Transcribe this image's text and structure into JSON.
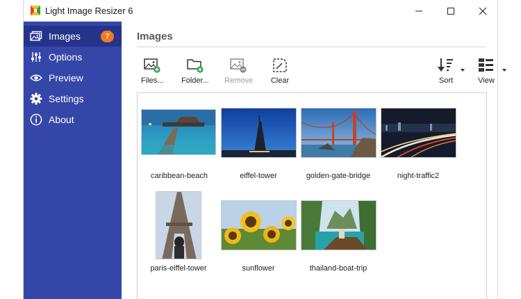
{
  "window": {
    "title": "Light Image Resizer 6"
  },
  "sidebar": {
    "items": [
      {
        "label": "Images",
        "icon": "images-icon",
        "active": true,
        "badge": "7"
      },
      {
        "label": "Options",
        "icon": "sliders-icon",
        "active": false
      },
      {
        "label": "Preview",
        "icon": "eye-icon",
        "active": false
      },
      {
        "label": "Settings",
        "icon": "gear-icon",
        "active": false
      },
      {
        "label": "About",
        "icon": "info-icon",
        "active": false
      }
    ]
  },
  "main": {
    "heading": "Images",
    "toolbar": {
      "files_label": "Files...",
      "folder_label": "Folder...",
      "remove_label": "Remove",
      "clear_label": "Clear",
      "sort_label": "Sort",
      "view_label": "View"
    },
    "images": [
      {
        "name": "caribbean-beach"
      },
      {
        "name": "eiffel-tower"
      },
      {
        "name": "golden-gate-bridge"
      },
      {
        "name": "night-traffic2"
      },
      {
        "name": "paris-eiffel-tower"
      },
      {
        "name": "sunflower"
      },
      {
        "name": "thailand-boat-trip"
      }
    ]
  },
  "colors": {
    "sidebar": "#3446a8",
    "sidebar_active": "#25348a",
    "badge": "#f07a1e",
    "add_green": "#2aa84a"
  }
}
